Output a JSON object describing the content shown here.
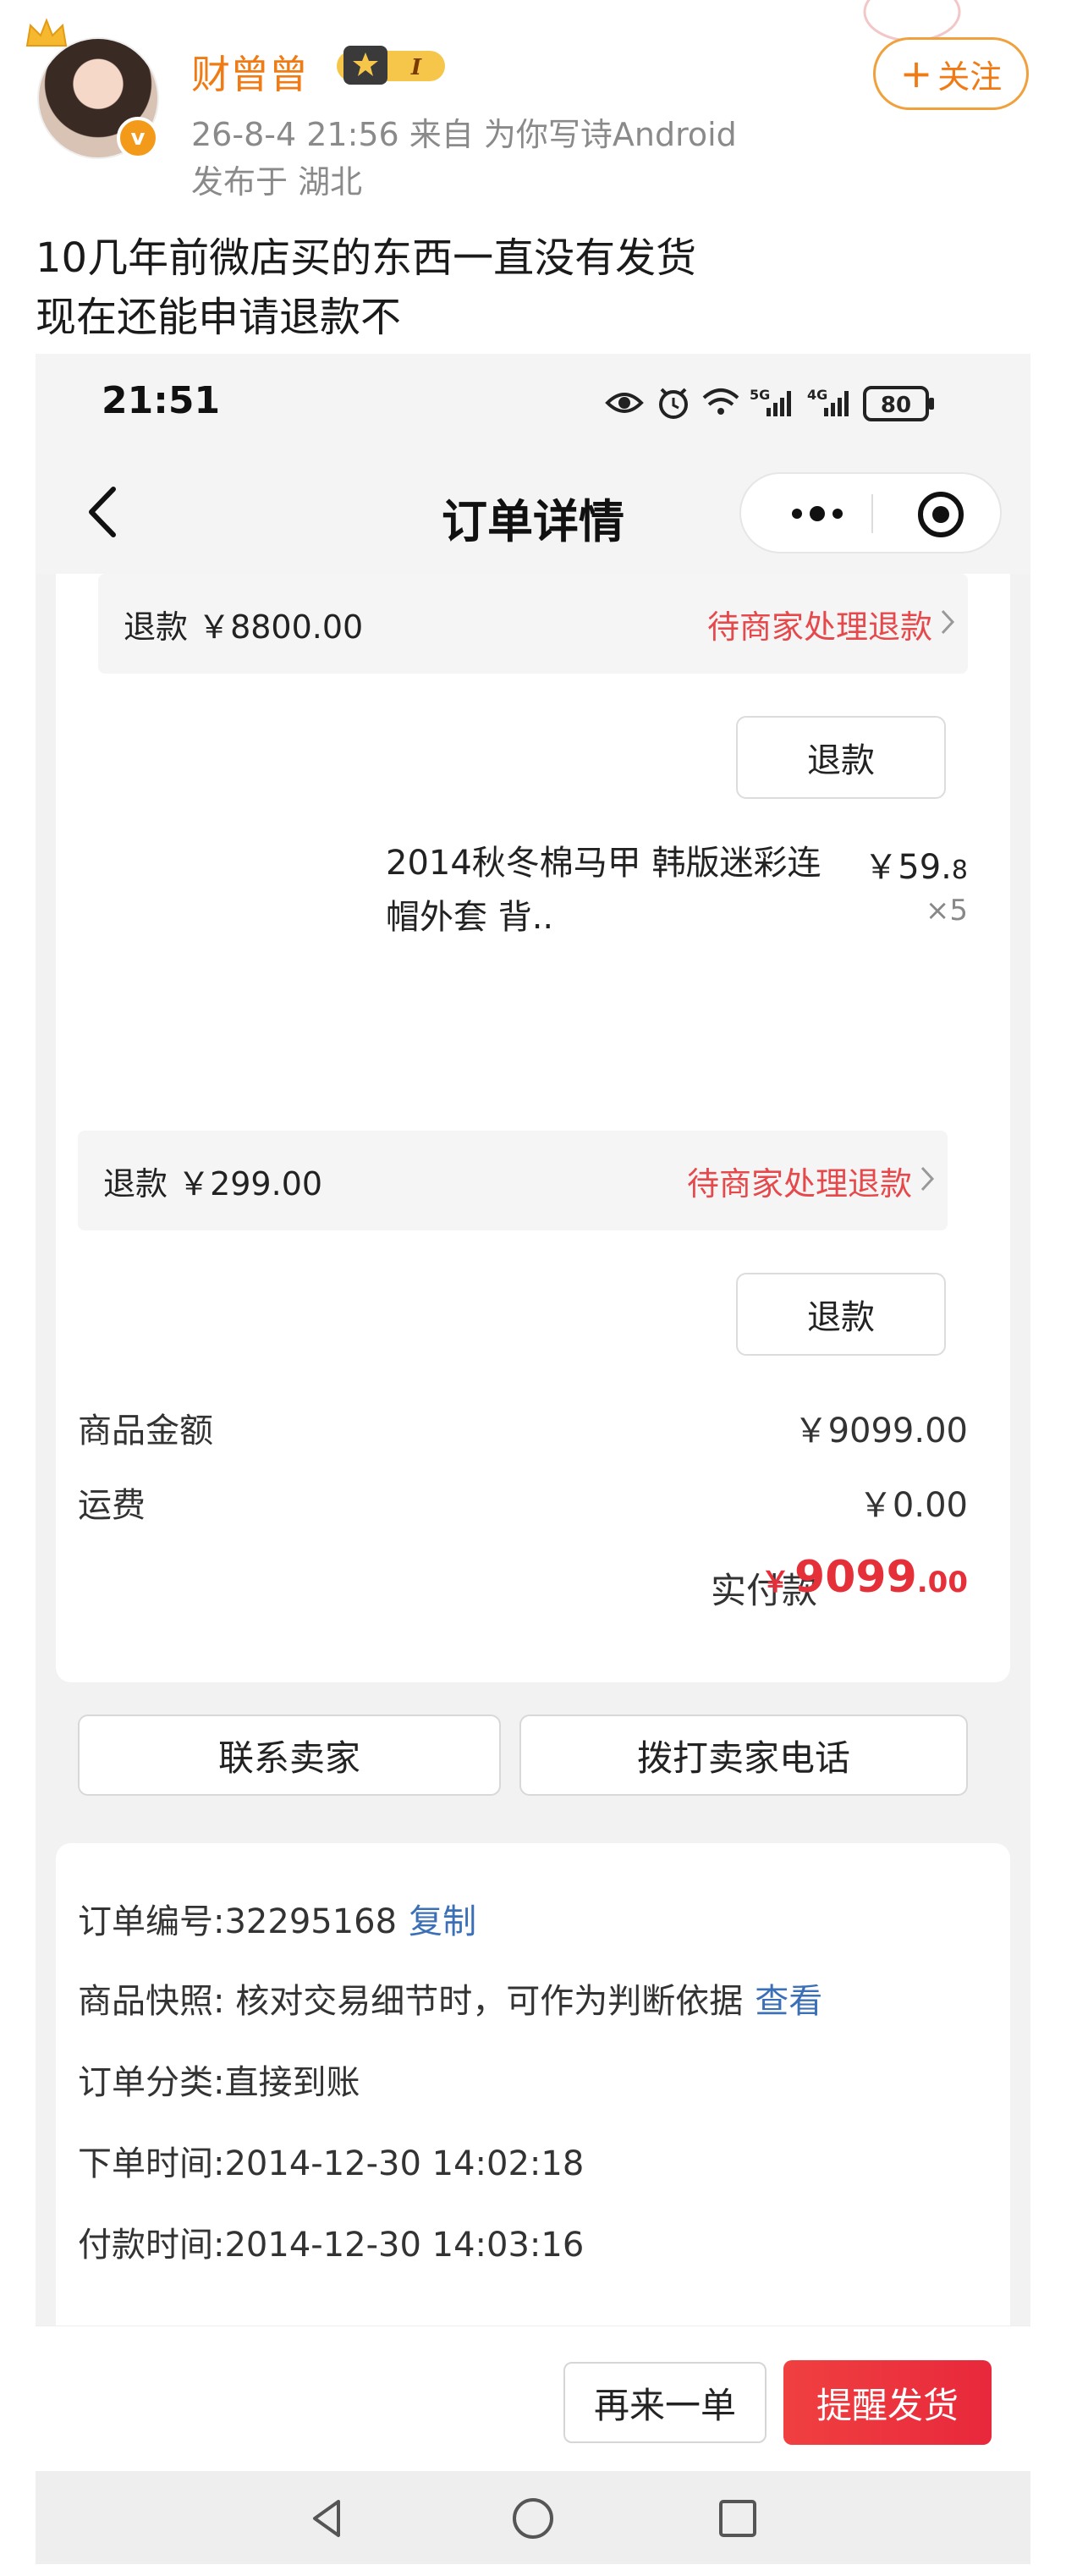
{
  "post": {
    "username": "财曾曾",
    "rank_badge": "I",
    "meta": "26-8-4 21:56  来自 为你写诗Android",
    "location": "发布于 湖北",
    "follow_label": "关注",
    "text_line1": "10几年前微店买的东西一直没有发货",
    "text_line2": "现在还能申请退款不"
  },
  "phone": {
    "clock": "21:51",
    "battery": "80",
    "page_title": "订单详情",
    "refund1": {
      "amount": "退款 ￥8800.00",
      "status": "待商家处理退款"
    },
    "refund_button_1": "退款",
    "product": {
      "name": "2014秋冬棉马甲 韩版迷彩连帽外套 背..",
      "price_int": "￥59.",
      "price_dec": "8",
      "qty": "×5"
    },
    "refund2": {
      "amount": "退款 ￥299.00",
      "status": "待商家处理退款"
    },
    "refund_button_2": "退款",
    "summary": {
      "goods_label": "商品金额",
      "goods_value": "￥9099.00",
      "shipping_label": "运费",
      "shipping_value": "￥0.00",
      "paid_label": "实付款",
      "paid_currency": "￥",
      "paid_int": "9099",
      "paid_dec": ".00"
    },
    "actions": {
      "contact": "联系卖家",
      "call": "拨打卖家电话"
    },
    "info": {
      "order_no": "订单编号:32295168",
      "copy": "复制",
      "snapshot": "商品快照: 核对交易细节时，可作为判断依据",
      "view": "查看",
      "category": "订单分类:直接到账",
      "order_time": "下单时间:2014-12-30 14:02:18",
      "pay_time": "付款时间:2014-12-30 14:03:16"
    },
    "bottom": {
      "again": "再来一单",
      "remind": "提醒发货"
    }
  },
  "colors": {
    "accent_orange": "#f07a14",
    "refund_red": "#e5494c",
    "pay_red": "#e5303a",
    "link_blue": "#3b6fb6"
  }
}
